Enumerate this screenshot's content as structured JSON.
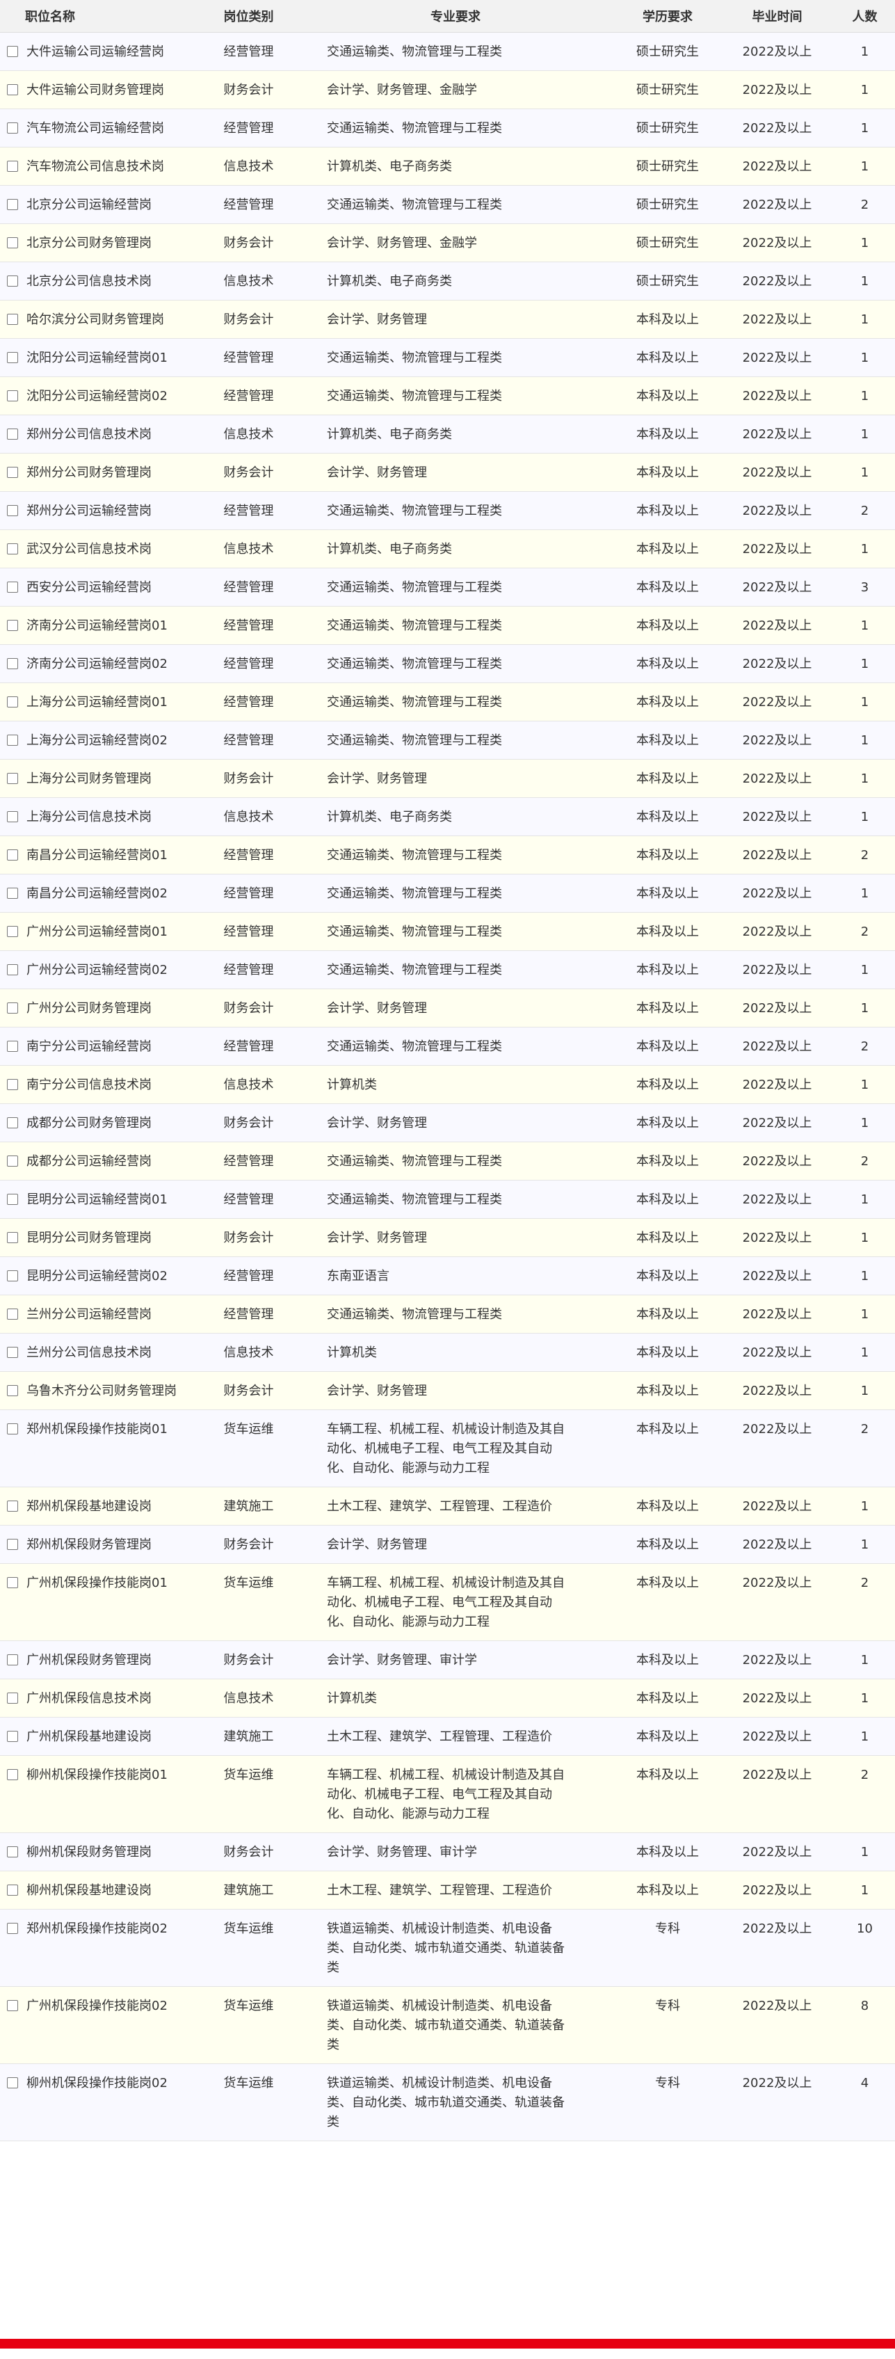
{
  "colors": {
    "accent": "#e60012",
    "header_bg": "#f2f2f2",
    "row_odd": "#f9f9ff",
    "row_even": "#fffff0"
  },
  "table": {
    "headers": {
      "name": "职位名称",
      "category": "岗位类别",
      "major": "专业要求",
      "education": "学历要求",
      "graduation": "毕业时间",
      "count": "人数"
    },
    "rows": [
      {
        "name": "大件运输公司运输经营岗",
        "category": "经营管理",
        "major": "交通运输类、物流管理与工程类",
        "education": "硕士研究生",
        "graduation": "2022及以上",
        "count": "1"
      },
      {
        "name": "大件运输公司财务管理岗",
        "category": "财务会计",
        "major": "会计学、财务管理、金融学",
        "education": "硕士研究生",
        "graduation": "2022及以上",
        "count": "1"
      },
      {
        "name": "汽车物流公司运输经营岗",
        "category": "经营管理",
        "major": "交通运输类、物流管理与工程类",
        "education": "硕士研究生",
        "graduation": "2022及以上",
        "count": "1"
      },
      {
        "name": "汽车物流公司信息技术岗",
        "category": "信息技术",
        "major": "计算机类、电子商务类",
        "education": "硕士研究生",
        "graduation": "2022及以上",
        "count": "1"
      },
      {
        "name": "北京分公司运输经营岗",
        "category": "经营管理",
        "major": "交通运输类、物流管理与工程类",
        "education": "硕士研究生",
        "graduation": "2022及以上",
        "count": "2"
      },
      {
        "name": "北京分公司财务管理岗",
        "category": "财务会计",
        "major": "会计学、财务管理、金融学",
        "education": "硕士研究生",
        "graduation": "2022及以上",
        "count": "1"
      },
      {
        "name": "北京分公司信息技术岗",
        "category": "信息技术",
        "major": "计算机类、电子商务类",
        "education": "硕士研究生",
        "graduation": "2022及以上",
        "count": "1"
      },
      {
        "name": "哈尔滨分公司财务管理岗",
        "category": "财务会计",
        "major": "会计学、财务管理",
        "education": "本科及以上",
        "graduation": "2022及以上",
        "count": "1"
      },
      {
        "name": "沈阳分公司运输经营岗01",
        "category": "经营管理",
        "major": "交通运输类、物流管理与工程类",
        "education": "本科及以上",
        "graduation": "2022及以上",
        "count": "1"
      },
      {
        "name": "沈阳分公司运输经营岗02",
        "category": "经营管理",
        "major": "交通运输类、物流管理与工程类",
        "education": "本科及以上",
        "graduation": "2022及以上",
        "count": "1"
      },
      {
        "name": "郑州分公司信息技术岗",
        "category": "信息技术",
        "major": "计算机类、电子商务类",
        "education": "本科及以上",
        "graduation": "2022及以上",
        "count": "1"
      },
      {
        "name": "郑州分公司财务管理岗",
        "category": "财务会计",
        "major": "会计学、财务管理",
        "education": "本科及以上",
        "graduation": "2022及以上",
        "count": "1"
      },
      {
        "name": "郑州分公司运输经营岗",
        "category": "经营管理",
        "major": "交通运输类、物流管理与工程类",
        "education": "本科及以上",
        "graduation": "2022及以上",
        "count": "2"
      },
      {
        "name": "武汉分公司信息技术岗",
        "category": "信息技术",
        "major": "计算机类、电子商务类",
        "education": "本科及以上",
        "graduation": "2022及以上",
        "count": "1"
      },
      {
        "name": "西安分公司运输经营岗",
        "category": "经营管理",
        "major": "交通运输类、物流管理与工程类",
        "education": "本科及以上",
        "graduation": "2022及以上",
        "count": "3"
      },
      {
        "name": "济南分公司运输经营岗01",
        "category": "经营管理",
        "major": "交通运输类、物流管理与工程类",
        "education": "本科及以上",
        "graduation": "2022及以上",
        "count": "1"
      },
      {
        "name": "济南分公司运输经营岗02",
        "category": "经营管理",
        "major": "交通运输类、物流管理与工程类",
        "education": "本科及以上",
        "graduation": "2022及以上",
        "count": "1"
      },
      {
        "name": "上海分公司运输经营岗01",
        "category": "经营管理",
        "major": "交通运输类、物流管理与工程类",
        "education": "本科及以上",
        "graduation": "2022及以上",
        "count": "1"
      },
      {
        "name": "上海分公司运输经营岗02",
        "category": "经营管理",
        "major": "交通运输类、物流管理与工程类",
        "education": "本科及以上",
        "graduation": "2022及以上",
        "count": "1"
      },
      {
        "name": "上海分公司财务管理岗",
        "category": "财务会计",
        "major": "会计学、财务管理",
        "education": "本科及以上",
        "graduation": "2022及以上",
        "count": "1"
      },
      {
        "name": "上海分公司信息技术岗",
        "category": "信息技术",
        "major": "计算机类、电子商务类",
        "education": "本科及以上",
        "graduation": "2022及以上",
        "count": "1"
      },
      {
        "name": "南昌分公司运输经营岗01",
        "category": "经营管理",
        "major": "交通运输类、物流管理与工程类",
        "education": "本科及以上",
        "graduation": "2022及以上",
        "count": "2"
      },
      {
        "name": "南昌分公司运输经营岗02",
        "category": "经营管理",
        "major": "交通运输类、物流管理与工程类",
        "education": "本科及以上",
        "graduation": "2022及以上",
        "count": "1"
      },
      {
        "name": "广州分公司运输经营岗01",
        "category": "经营管理",
        "major": "交通运输类、物流管理与工程类",
        "education": "本科及以上",
        "graduation": "2022及以上",
        "count": "2"
      },
      {
        "name": "广州分公司运输经营岗02",
        "category": "经营管理",
        "major": "交通运输类、物流管理与工程类",
        "education": "本科及以上",
        "graduation": "2022及以上",
        "count": "1"
      },
      {
        "name": "广州分公司财务管理岗",
        "category": "财务会计",
        "major": "会计学、财务管理",
        "education": "本科及以上",
        "graduation": "2022及以上",
        "count": "1"
      },
      {
        "name": "南宁分公司运输经营岗",
        "category": "经营管理",
        "major": "交通运输类、物流管理与工程类",
        "education": "本科及以上",
        "graduation": "2022及以上",
        "count": "2"
      },
      {
        "name": "南宁分公司信息技术岗",
        "category": "信息技术",
        "major": "计算机类",
        "education": "本科及以上",
        "graduation": "2022及以上",
        "count": "1"
      },
      {
        "name": "成都分公司财务管理岗",
        "category": "财务会计",
        "major": "会计学、财务管理",
        "education": "本科及以上",
        "graduation": "2022及以上",
        "count": "1"
      },
      {
        "name": "成都分公司运输经营岗",
        "category": "经营管理",
        "major": "交通运输类、物流管理与工程类",
        "education": "本科及以上",
        "graduation": "2022及以上",
        "count": "2"
      },
      {
        "name": "昆明分公司运输经营岗01",
        "category": "经营管理",
        "major": "交通运输类、物流管理与工程类",
        "education": "本科及以上",
        "graduation": "2022及以上",
        "count": "1"
      },
      {
        "name": "昆明分公司财务管理岗",
        "category": "财务会计",
        "major": "会计学、财务管理",
        "education": "本科及以上",
        "graduation": "2022及以上",
        "count": "1"
      },
      {
        "name": "昆明分公司运输经营岗02",
        "category": "经营管理",
        "major": "东南亚语言",
        "education": "本科及以上",
        "graduation": "2022及以上",
        "count": "1"
      },
      {
        "name": "兰州分公司运输经营岗",
        "category": "经营管理",
        "major": "交通运输类、物流管理与工程类",
        "education": "本科及以上",
        "graduation": "2022及以上",
        "count": "1"
      },
      {
        "name": "兰州分公司信息技术岗",
        "category": "信息技术",
        "major": "计算机类",
        "education": "本科及以上",
        "graduation": "2022及以上",
        "count": "1"
      },
      {
        "name": "乌鲁木齐分公司财务管理岗",
        "category": "财务会计",
        "major": "会计学、财务管理",
        "education": "本科及以上",
        "graduation": "2022及以上",
        "count": "1"
      },
      {
        "name": "郑州机保段操作技能岗01",
        "category": "货车运维",
        "major": "车辆工程、机械工程、机械设计制造及其自动化、机械电子工程、电气工程及其自动化、自动化、能源与动力工程",
        "education": "本科及以上",
        "graduation": "2022及以上",
        "count": "2"
      },
      {
        "name": "郑州机保段基地建设岗",
        "category": "建筑施工",
        "major": "土木工程、建筑学、工程管理、工程造价",
        "education": "本科及以上",
        "graduation": "2022及以上",
        "count": "1"
      },
      {
        "name": "郑州机保段财务管理岗",
        "category": "财务会计",
        "major": "会计学、财务管理",
        "education": "本科及以上",
        "graduation": "2022及以上",
        "count": "1"
      },
      {
        "name": "广州机保段操作技能岗01",
        "category": "货车运维",
        "major": "车辆工程、机械工程、机械设计制造及其自动化、机械电子工程、电气工程及其自动化、自动化、能源与动力工程",
        "education": "本科及以上",
        "graduation": "2022及以上",
        "count": "2"
      },
      {
        "name": "广州机保段财务管理岗",
        "category": "财务会计",
        "major": "会计学、财务管理、审计学",
        "education": "本科及以上",
        "graduation": "2022及以上",
        "count": "1"
      },
      {
        "name": "广州机保段信息技术岗",
        "category": "信息技术",
        "major": "计算机类",
        "education": "本科及以上",
        "graduation": "2022及以上",
        "count": "1"
      },
      {
        "name": "广州机保段基地建设岗",
        "category": "建筑施工",
        "major": "土木工程、建筑学、工程管理、工程造价",
        "education": "本科及以上",
        "graduation": "2022及以上",
        "count": "1"
      },
      {
        "name": "柳州机保段操作技能岗01",
        "category": "货车运维",
        "major": "车辆工程、机械工程、机械设计制造及其自动化、机械电子工程、电气工程及其自动化、自动化、能源与动力工程",
        "education": "本科及以上",
        "graduation": "2022及以上",
        "count": "2"
      },
      {
        "name": "柳州机保段财务管理岗",
        "category": "财务会计",
        "major": "会计学、财务管理、审计学",
        "education": "本科及以上",
        "graduation": "2022及以上",
        "count": "1"
      },
      {
        "name": "柳州机保段基地建设岗",
        "category": "建筑施工",
        "major": "土木工程、建筑学、工程管理、工程造价",
        "education": "本科及以上",
        "graduation": "2022及以上",
        "count": "1"
      },
      {
        "name": "郑州机保段操作技能岗02",
        "category": "货车运维",
        "major": "铁道运输类、机械设计制造类、机电设备类、自动化类、城市轨道交通类、轨道装备类",
        "education": "专科",
        "graduation": "2022及以上",
        "count": "10"
      },
      {
        "name": "广州机保段操作技能岗02",
        "category": "货车运维",
        "major": "铁道运输类、机械设计制造类、机电设备类、自动化类、城市轨道交通类、轨道装备类",
        "education": "专科",
        "graduation": "2022及以上",
        "count": "8"
      },
      {
        "name": "柳州机保段操作技能岗02",
        "category": "货车运维",
        "major": "铁道运输类、机械设计制造类、机电设备类、自动化类、城市轨道交通类、轨道装备类",
        "education": "专科",
        "graduation": "2022及以上",
        "count": "4"
      }
    ]
  }
}
